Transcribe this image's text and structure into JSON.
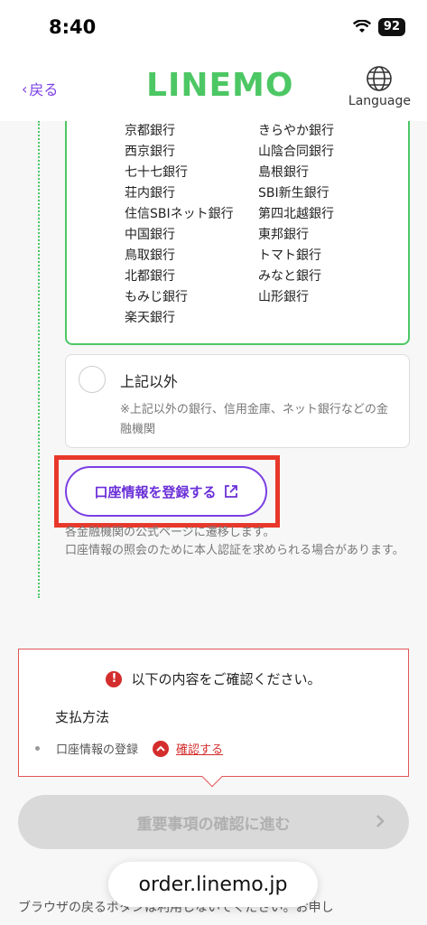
{
  "status": {
    "time": "8:40",
    "battery": "92"
  },
  "header": {
    "back_label": "戻る",
    "logo": "LINEMO",
    "language_label": "Language"
  },
  "banks": {
    "left": [
      "京都銀行",
      "西京銀行",
      "七十七銀行",
      "荘内銀行",
      "住信SBIネット銀行",
      "中国銀行",
      "鳥取銀行",
      "北都銀行",
      "もみじ銀行",
      "楽天銀行"
    ],
    "right": [
      "きらやか銀行",
      "山陰合同銀行",
      "島根銀行",
      "SBI新生銀行",
      "第四北越銀行",
      "東邦銀行",
      "トマト銀行",
      "みなと銀行",
      "山形銀行"
    ]
  },
  "other_option": {
    "title": "上記以外",
    "note": "※上記以外の銀行、信用金庫、ネット銀行などの金融機関"
  },
  "register_button": {
    "label": "口座情報を登録する"
  },
  "redirect_note": {
    "line1": "各金融機関の公式ページに遷移します。",
    "line2": "口座情報の照会のために本人認証を求められる場合があります。"
  },
  "confirm": {
    "heading": "以下の内容をご確認ください。",
    "section": "支払方法",
    "item_label": "口座情報の登録",
    "link_label": "確認する"
  },
  "next_button": {
    "label": "重要事項の確認に進む"
  },
  "footer": {
    "text": "ブラウザの戻るボタンは利用しないでください。お申し"
  },
  "url_bar": {
    "url": "order.linemo.jp"
  },
  "colors": {
    "accent": "#4cc764",
    "purple": "#7b3fe4",
    "alert": "#d42d2d"
  }
}
